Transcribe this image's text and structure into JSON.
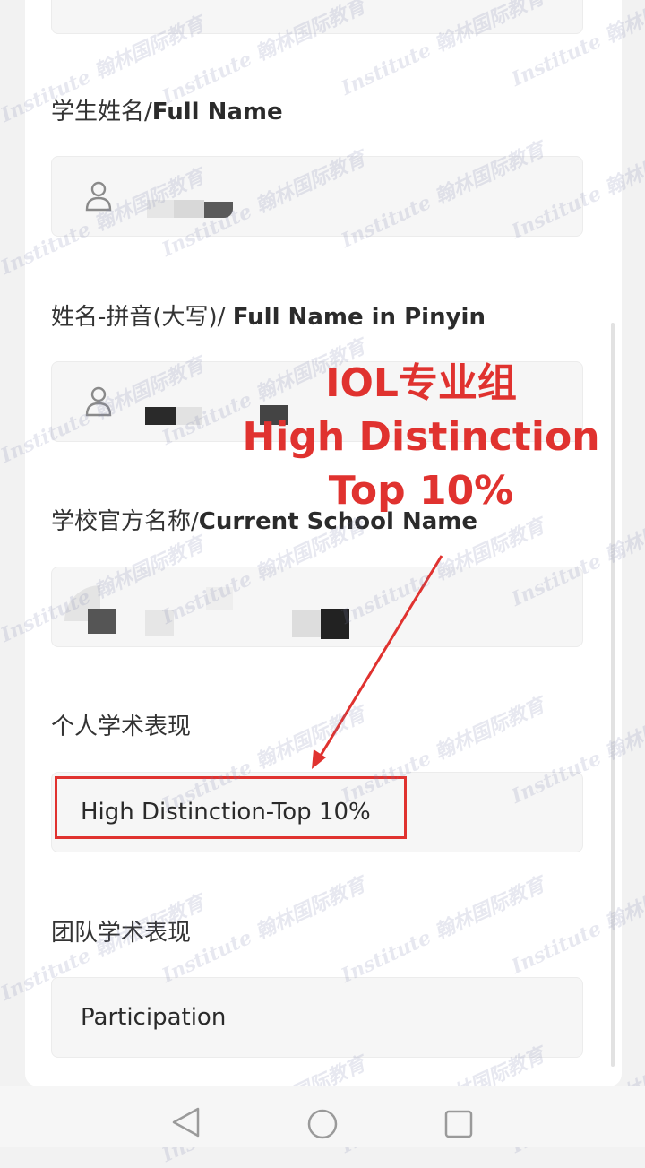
{
  "form": {
    "student_name_label_cn": "学生姓名/",
    "student_name_label_en": "Full Name",
    "pinyin_label_cn": "姓名-拼音(大写)/ ",
    "pinyin_label_en": "Full Name in Pinyin",
    "school_label_cn": "学校官方名称/",
    "school_label_en": "Current School Name",
    "individual_label": "个人学术表现",
    "individual_value": "High Distinction-Top 10%",
    "team_label": "团队学术表现",
    "team_value": "Participation"
  },
  "annotation": {
    "line1": "IOL专业组",
    "line2": "High Distinction",
    "line3": "Top 10%",
    "color": "#e0322f"
  },
  "watermark": {
    "text": "Institute 翰林国际教育"
  },
  "icons": {
    "user": "user-icon",
    "back": "back-triangle-icon",
    "home": "home-circle-icon",
    "recents": "recents-square-icon"
  }
}
